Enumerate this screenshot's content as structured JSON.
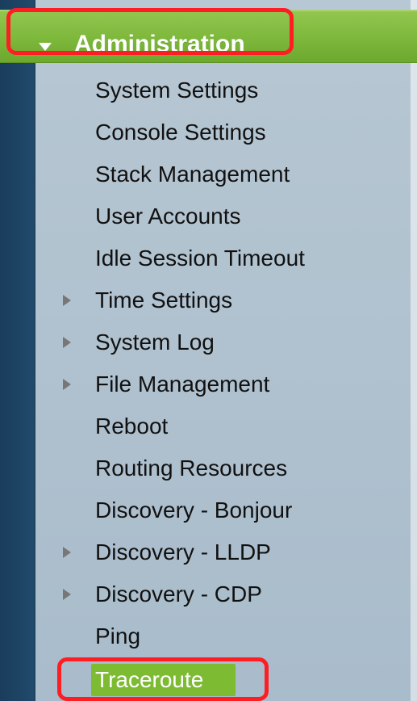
{
  "sidebar": {
    "section_title": "Administration",
    "items": [
      {
        "label": "System Settings",
        "has_arrow": false
      },
      {
        "label": "Console Settings",
        "has_arrow": false
      },
      {
        "label": "Stack Management",
        "has_arrow": false
      },
      {
        "label": "User Accounts",
        "has_arrow": false
      },
      {
        "label": "Idle Session Timeout",
        "has_arrow": false
      },
      {
        "label": "Time Settings",
        "has_arrow": true
      },
      {
        "label": "System Log",
        "has_arrow": true
      },
      {
        "label": "File Management",
        "has_arrow": true
      },
      {
        "label": "Reboot",
        "has_arrow": false
      },
      {
        "label": "Routing Resources",
        "has_arrow": false
      },
      {
        "label": "Discovery - Bonjour",
        "has_arrow": false
      },
      {
        "label": "Discovery - LLDP",
        "has_arrow": true
      },
      {
        "label": "Discovery - CDP",
        "has_arrow": true
      },
      {
        "label": "Ping",
        "has_arrow": false
      },
      {
        "label": "Traceroute",
        "has_arrow": false,
        "selected": true
      }
    ]
  },
  "colors": {
    "sidebar_background": "#b7c7d3",
    "left_bar": "#1a3d5c",
    "header_green": "#7db83b",
    "highlight_red": "#ff1d24",
    "selected_green": "#7dbb32",
    "menu_text": "#111111",
    "arrow": "#777777"
  },
  "icons": {
    "expanded_section": "caret-down-icon",
    "collapsed_submenu": "caret-right-icon"
  }
}
